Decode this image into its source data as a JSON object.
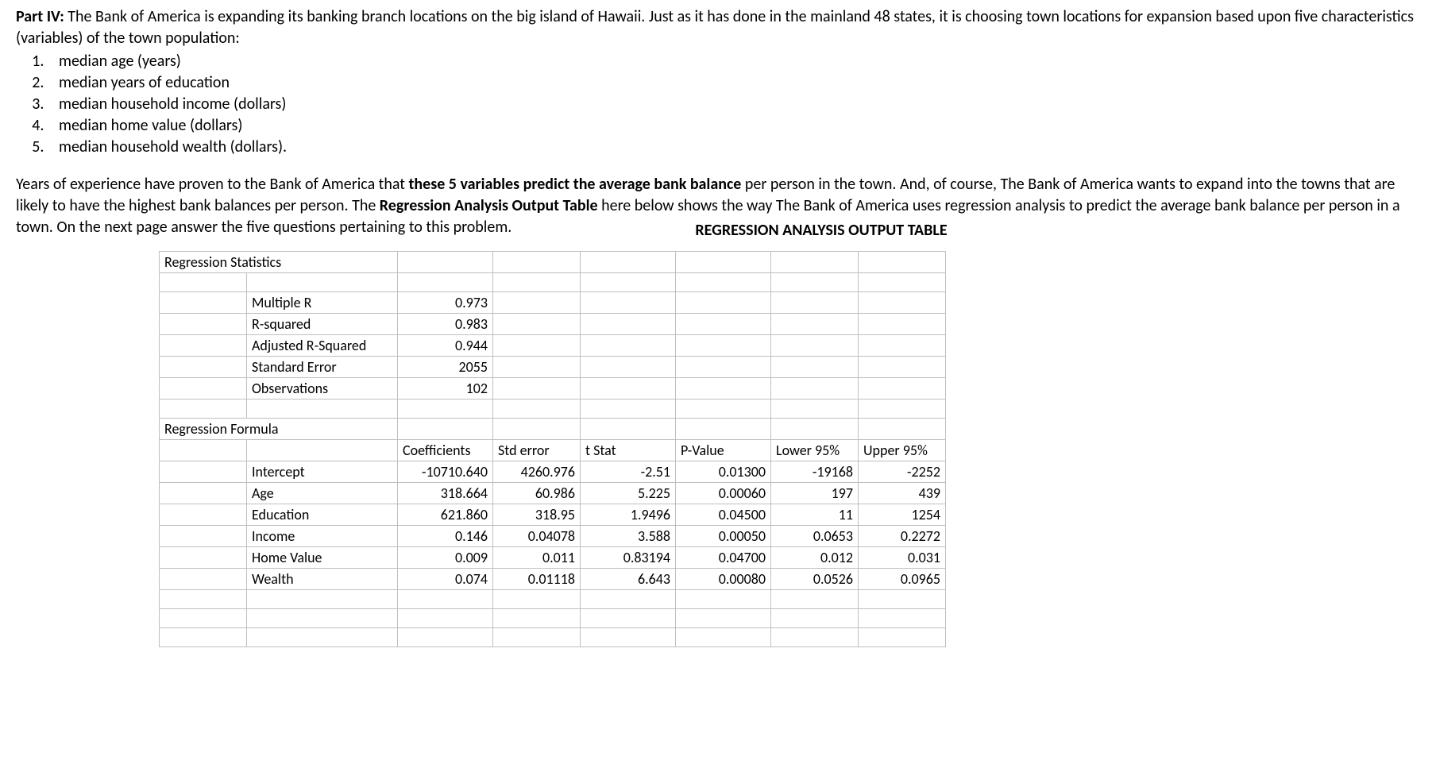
{
  "intro": {
    "part_label": "Part IV:",
    "sentence1": " The Bank of America is expanding its banking branch locations on the big island of Hawaii.  Just as it has done in the mainland 48 states, it is choosing town locations for expansion based upon five characteristics (variables) of the town population:"
  },
  "variables": [
    "median age (years)",
    "median years of education",
    "median household income (dollars)",
    "median home value (dollars)",
    "median household wealth (dollars)."
  ],
  "para2": {
    "seg1": "Years of experience have proven to the Bank of America that ",
    "bold1": "these 5 variables predict the average bank balance",
    "seg2": " per person in the town.  And, of course, The Bank of America wants to expand into the towns that are likely to have the highest bank balances per person.  The ",
    "bold2": "Regression Analysis Output Table",
    "seg3": " here below shows the way The Bank of America uses regression analysis to predict the average bank balance per person in a town.  On the next page answer the five questions pertaining to this problem."
  },
  "table_title": "REGRESSION ANALYSIS OUTPUT TABLE",
  "stats_header": "Regression Statistics",
  "stats": [
    {
      "label": "Multiple R",
      "value": "0.973"
    },
    {
      "label": "R-squared",
      "value": "0.983"
    },
    {
      "label": "Adjusted R-Squared",
      "value": "0.944"
    },
    {
      "label": "Standard Error",
      "value": "2055"
    },
    {
      "label": "Observations",
      "value": "102"
    }
  ],
  "formula_header": "Regression Formula",
  "col_headers": {
    "coef": "Coefficients",
    "se": "Std error",
    "t": "t Stat",
    "p": "P-Value",
    "lo": "Lower 95%",
    "hi": "Upper 95%"
  },
  "rows": [
    {
      "label": "Intercept",
      "coef": "-10710.640",
      "se": "4260.976",
      "t": "-2.51",
      "p": "0.01300",
      "lo": "-19168",
      "hi": "-2252"
    },
    {
      "label": "Age",
      "coef": "318.664",
      "se": "60.986",
      "t": "5.225",
      "p": "0.00060",
      "lo": "197",
      "hi": "439"
    },
    {
      "label": "Education",
      "coef": "621.860",
      "se": "318.95",
      "t": "1.9496",
      "p": "0.04500",
      "lo": "11",
      "hi": "1254"
    },
    {
      "label": "Income",
      "coef": "0.146",
      "se": "0.04078",
      "t": "3.588",
      "p": "0.00050",
      "lo": "0.0653",
      "hi": "0.2272"
    },
    {
      "label": "Home Value",
      "coef": "0.009",
      "se": "0.011",
      "t": "0.83194",
      "p": "0.04700",
      "lo": "0.012",
      "hi": "0.031"
    },
    {
      "label": "Wealth",
      "coef": "0.074",
      "se": "0.01118",
      "t": "6.643",
      "p": "0.00080",
      "lo": "0.0526",
      "hi": "0.0965"
    }
  ]
}
